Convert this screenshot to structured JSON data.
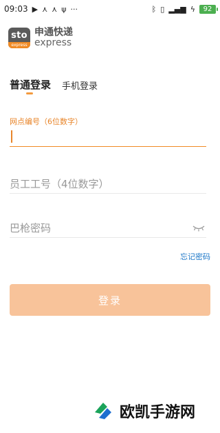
{
  "status": {
    "time": "09:03",
    "battery": "92",
    "icons_left": [
      "play-icon",
      "network-icon",
      "network-icon",
      "usb-icon",
      "more-icon"
    ],
    "icons_right": [
      "bluetooth-icon",
      "vibrate-icon",
      "signal-icon",
      "charging-icon",
      "battery-icon"
    ]
  },
  "brand": {
    "logo_text": "sto",
    "logo_sub": "express",
    "name_cn": "申通快递",
    "name_en": "express"
  },
  "tabs": [
    {
      "label": "普通登录",
      "active": true
    },
    {
      "label": "手机登录",
      "active": false
    }
  ],
  "form": {
    "outlet_label": "网点编号（6位数字）",
    "employee_placeholder": "员工工号（4位数字）",
    "password_placeholder": "巴枪密码",
    "forgot": "忘记密码",
    "submit": "登录"
  },
  "watermark": "欧凯手游网",
  "colors": {
    "accent": "#f08a24",
    "button_bg": "#f8c39a",
    "link": "#1e78c8"
  }
}
